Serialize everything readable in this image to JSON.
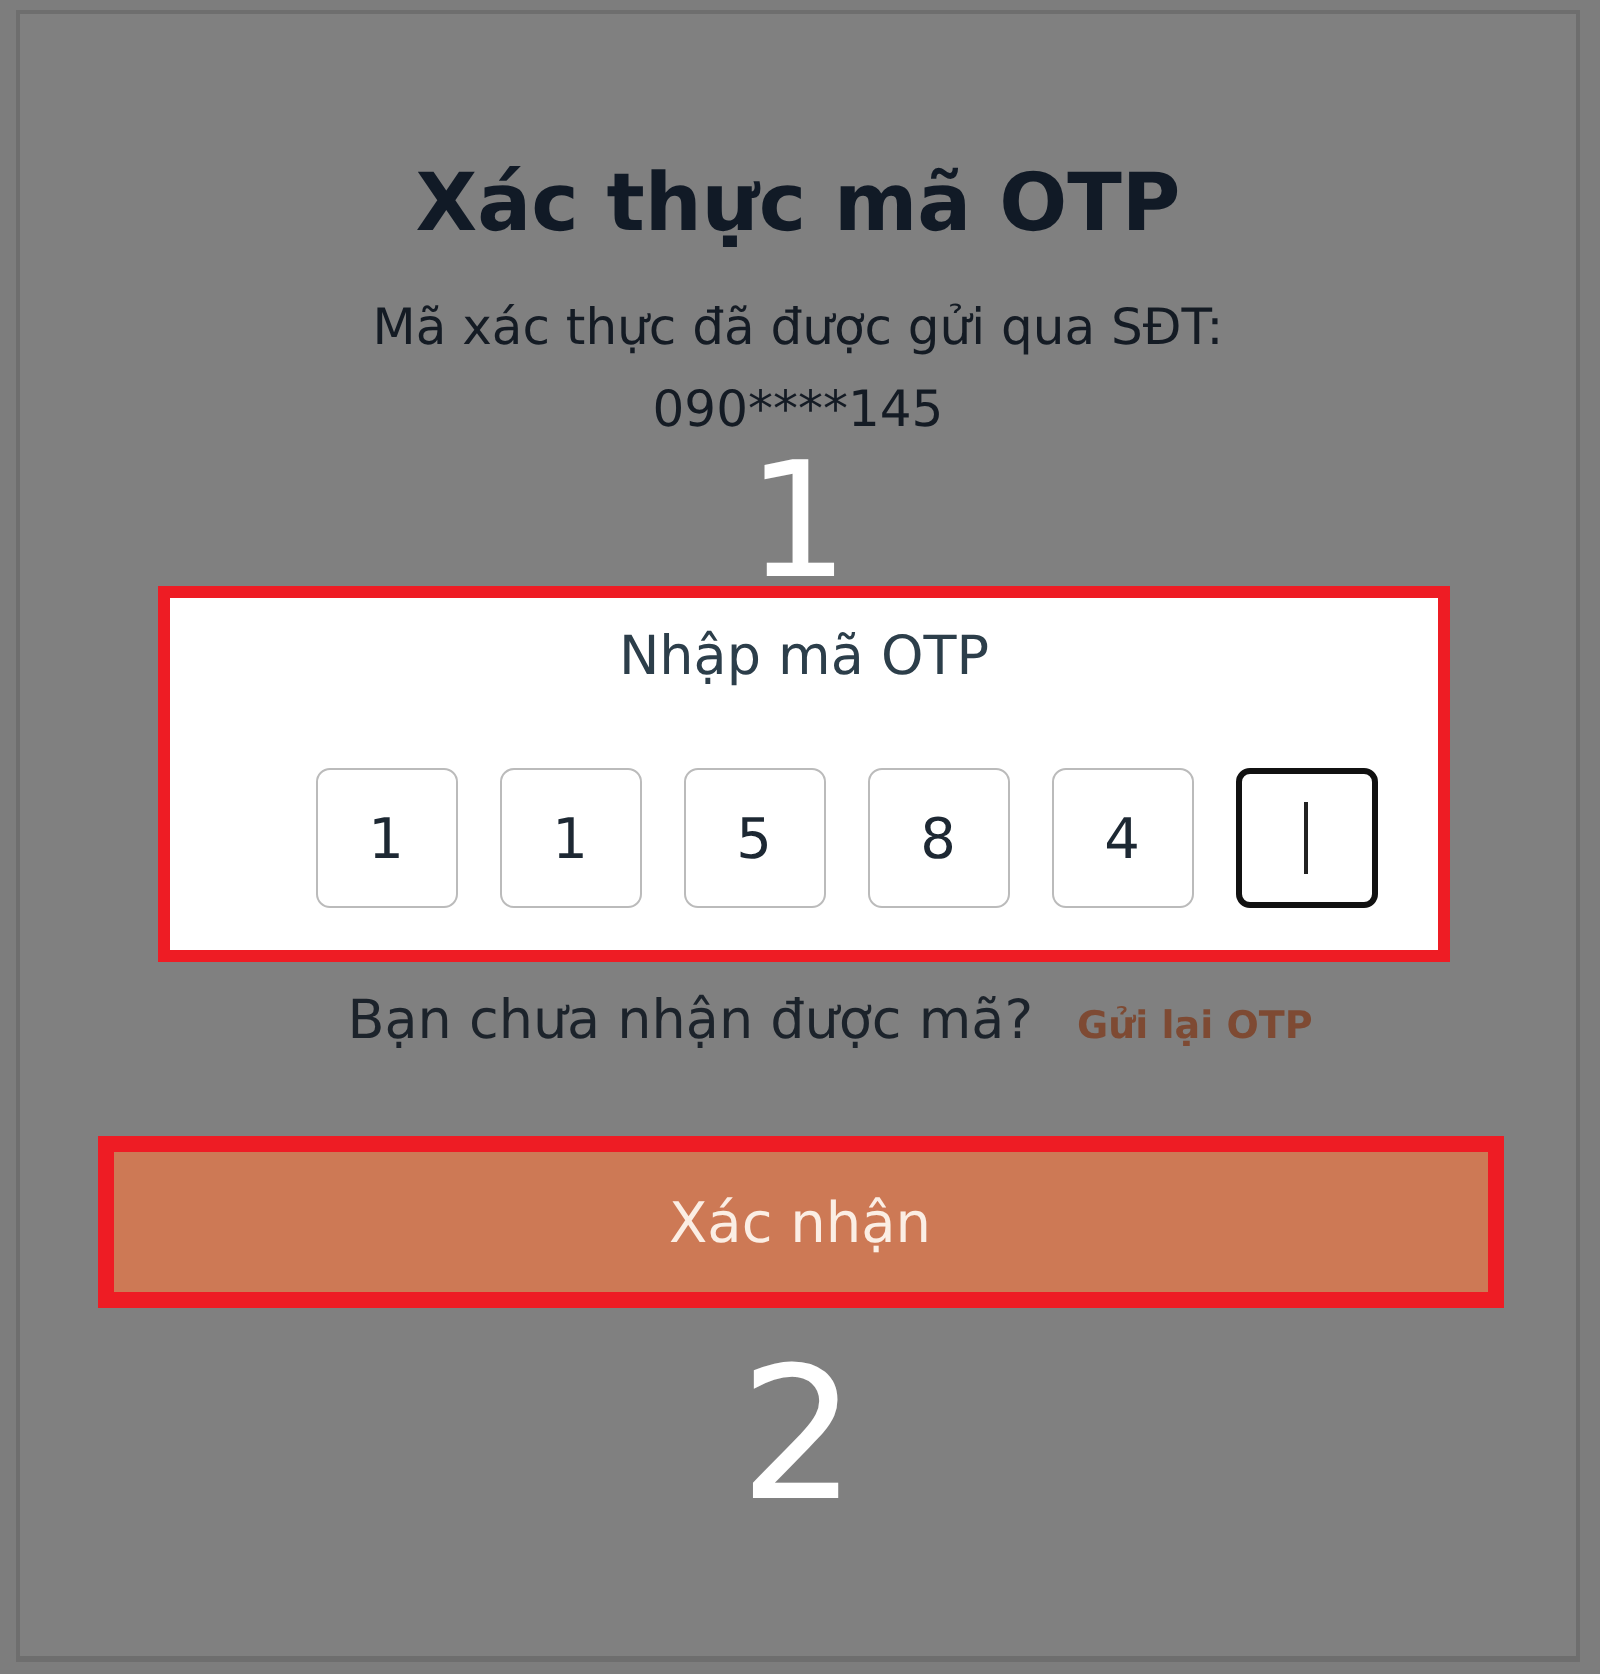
{
  "dialog": {
    "title": "Xác thực mã OTP",
    "message": "Mã xác thực đã được gửi qua SĐT:",
    "phone": "090****145"
  },
  "otp": {
    "label": "Nhập mã OTP",
    "digits": [
      {
        "value": "1",
        "focused": false
      },
      {
        "value": "1",
        "focused": false
      },
      {
        "value": "5",
        "focused": false
      },
      {
        "value": "8",
        "focused": false
      },
      {
        "value": "4",
        "focused": false
      },
      {
        "focused": true
      }
    ]
  },
  "resend": {
    "prompt": "Bạn chưa nhận được mã?",
    "link": "Gửi lại OTP"
  },
  "confirm_button": "Xác nhận",
  "annotations": [
    {
      "label": "1"
    },
    {
      "label": "2"
    }
  ]
}
